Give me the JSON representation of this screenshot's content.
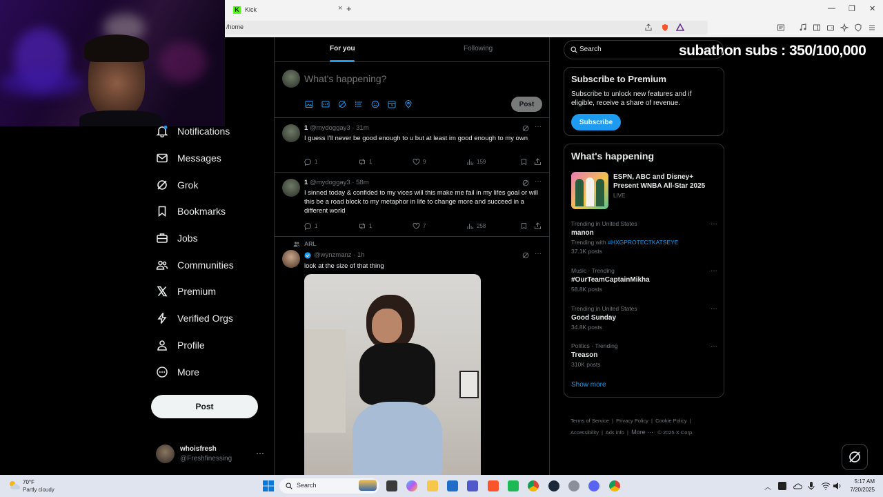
{
  "browser": {
    "tab_title": "Kick",
    "url": "/home",
    "new_tab": "+",
    "tab_close": "×"
  },
  "overlay": {
    "text": "subathon subs : 350/100,000"
  },
  "nav": {
    "items": [
      {
        "label": "Notifications",
        "icon": "bell-icon"
      },
      {
        "label": "Messages",
        "icon": "mail-icon"
      },
      {
        "label": "Grok",
        "icon": "grok-icon"
      },
      {
        "label": "Bookmarks",
        "icon": "bookmark-icon"
      },
      {
        "label": "Jobs",
        "icon": "briefcase-icon"
      },
      {
        "label": "Communities",
        "icon": "people-icon"
      },
      {
        "label": "Premium",
        "icon": "x-logo-icon"
      },
      {
        "label": "Verified Orgs",
        "icon": "lightning-icon"
      },
      {
        "label": "Profile",
        "icon": "person-icon"
      },
      {
        "label": "More",
        "icon": "more-circle-icon"
      }
    ],
    "post_label": "Post",
    "account": {
      "name": "whoisfresh",
      "handle": "@Freshfinessing",
      "more": "···"
    }
  },
  "feed": {
    "tabs": {
      "for_you": "For you",
      "following": "Following"
    },
    "composer": {
      "placeholder": "What's happening?",
      "post_label": "Post"
    },
    "tweets": [
      {
        "name": "1",
        "handle": "@mydoggay3 · 31m",
        "text": "I guess I'll never be good enough to u but at least im good enough to my own",
        "replies": "1",
        "reposts": "1",
        "likes": "9",
        "views": "159"
      },
      {
        "name": "1",
        "handle": "@mydoggay3 · 58m",
        "text": "I sinned today & confided to my vices will this make me fail in my lifes goal or will this be a road block to my metaphor in life to change more and succeed in a different world",
        "replies": "1",
        "reposts": "1",
        "likes": "7",
        "views": "258"
      },
      {
        "context": "ARL",
        "handle": "@wynzmanz · 1h",
        "text": "look at the size of that thing"
      }
    ]
  },
  "right": {
    "search_placeholder": "Search",
    "premium": {
      "title": "Subscribe to Premium",
      "body": "Subscribe to unlock new features and if eligible, receive a share of revenue.",
      "button": "Subscribe"
    },
    "happening": {
      "title": "What's happening",
      "featured": {
        "title": "ESPN, ABC and Disney+ Present WNBA All-Star 2025",
        "status": "LIVE"
      },
      "trends": [
        {
          "context": "Trending in United States",
          "title": "manon",
          "with_label": "Trending with",
          "with_tag": "#HXGPROTECTKATSEYE",
          "count": "37.1K posts"
        },
        {
          "context": "Music · Trending",
          "title": "#OurTeamCaptainMikha",
          "count": "58.8K posts"
        },
        {
          "context": "Trending in United States",
          "title": "Good Sunday",
          "count": "34.8K posts"
        },
        {
          "context": "Politics · Trending",
          "title": "Treason",
          "count": "310K posts"
        }
      ],
      "show_more": "Show more"
    },
    "footer": {
      "links": [
        "Terms of Service",
        "Privacy Policy",
        "Cookie Policy",
        "Accessibility",
        "Ads info",
        "More ···"
      ],
      "copyright": "© 2025 X Corp."
    }
  },
  "taskbar": {
    "weather_temp": "70°F",
    "weather_desc": "Partly cloudy",
    "search": "Search",
    "time": "5:17 AM",
    "date": "7/20/2025"
  },
  "colors": {
    "accent": "#1d9bf0",
    "background": "#000000",
    "border": "#2f3336",
    "muted": "#71767b"
  }
}
